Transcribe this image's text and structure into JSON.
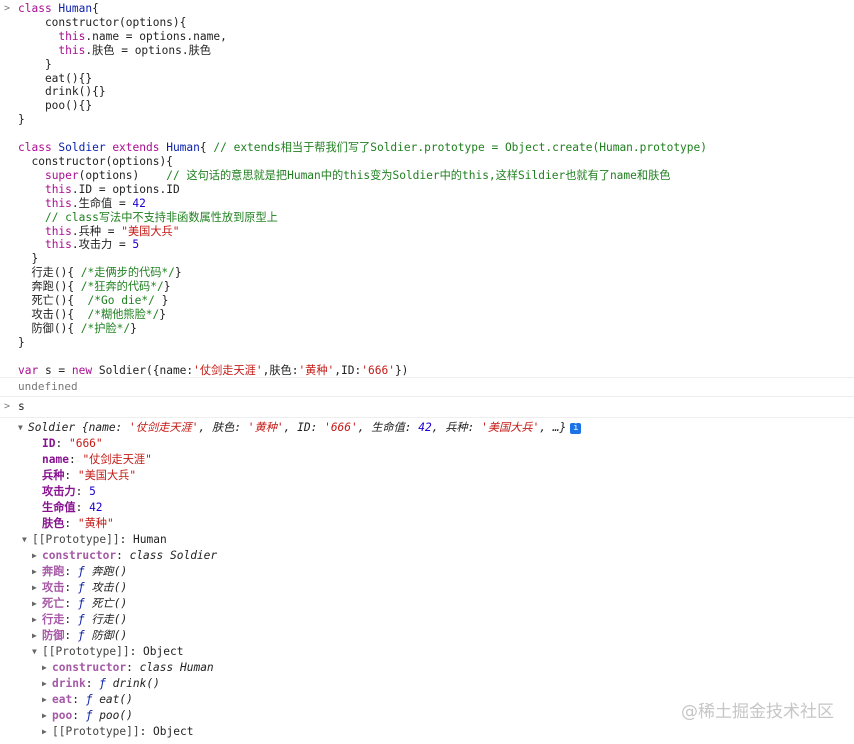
{
  "input1": {
    "prompt": ">",
    "lines": [
      [
        [
          "k",
          "class "
        ],
        [
          "t",
          "Human"
        ],
        [
          "p",
          "{"
        ]
      ],
      [
        [
          "p",
          "    constructor(options){"
        ]
      ],
      [
        [
          "p",
          "      "
        ],
        [
          "k",
          "this"
        ],
        [
          "p",
          ".name = options.name,"
        ]
      ],
      [
        [
          "p",
          "      "
        ],
        [
          "k",
          "this"
        ],
        [
          "p",
          ".肤色 = options.肤色"
        ]
      ],
      [
        [
          "p",
          "    }"
        ]
      ],
      [
        [
          "p",
          "    eat(){}"
        ]
      ],
      [
        [
          "p",
          "    drink(){}"
        ]
      ],
      [
        [
          "p",
          "    poo(){}"
        ]
      ],
      [
        [
          "p",
          "}"
        ]
      ],
      [
        [
          "p",
          ""
        ]
      ],
      [
        [
          "k",
          "class "
        ],
        [
          "t",
          "Soldier"
        ],
        [
          "k",
          " extends "
        ],
        [
          "t",
          "Human"
        ],
        [
          "p",
          "{ "
        ],
        [
          "c",
          "// extends相当于帮我们写了Soldier.prototype = Object.create(Human.prototype)"
        ]
      ],
      [
        [
          "p",
          "  constructor(options){"
        ]
      ],
      [
        [
          "p",
          "    "
        ],
        [
          "k",
          "super"
        ],
        [
          "p",
          "(options)    "
        ],
        [
          "c",
          "// 这句话的意思就是把Human中的this变为Soldier中的this,这样Sildier也就有了name和肤色"
        ]
      ],
      [
        [
          "p",
          "    "
        ],
        [
          "k",
          "this"
        ],
        [
          "p",
          ".ID = options.ID"
        ]
      ],
      [
        [
          "p",
          "    "
        ],
        [
          "k",
          "this"
        ],
        [
          "p",
          ".生命值 = "
        ],
        [
          "n",
          "42"
        ]
      ],
      [
        [
          "p",
          "    "
        ],
        [
          "c",
          "// class写法中不支持非函数属性放到原型上"
        ]
      ],
      [
        [
          "p",
          "    "
        ],
        [
          "k",
          "this"
        ],
        [
          "p",
          ".兵种 = "
        ],
        [
          "s",
          "\"美国大兵\""
        ]
      ],
      [
        [
          "p",
          "    "
        ],
        [
          "k",
          "this"
        ],
        [
          "p",
          ".攻击力 = "
        ],
        [
          "n",
          "5"
        ]
      ],
      [
        [
          "p",
          "  }"
        ]
      ],
      [
        [
          "p",
          "  行走(){ "
        ],
        [
          "c",
          "/*走俩步的代码*/"
        ],
        [
          "p",
          "}"
        ]
      ],
      [
        [
          "p",
          "  奔跑(){ "
        ],
        [
          "c",
          "/*狂奔的代码*/"
        ],
        [
          "p",
          "}"
        ]
      ],
      [
        [
          "p",
          "  死亡(){  "
        ],
        [
          "c",
          "/*Go die*/"
        ],
        [
          "p",
          " }"
        ]
      ],
      [
        [
          "p",
          "  攻击(){  "
        ],
        [
          "c",
          "/*糊他熊脸*/"
        ],
        [
          "p",
          "}"
        ]
      ],
      [
        [
          "p",
          "  防御(){ "
        ],
        [
          "c",
          "/*护脸*/"
        ],
        [
          "p",
          "}"
        ]
      ],
      [
        [
          "p",
          "}"
        ]
      ],
      [
        [
          "p",
          ""
        ]
      ],
      [
        [
          "k",
          "var "
        ],
        [
          "p",
          "s = "
        ],
        [
          "k",
          "new "
        ],
        [
          "p",
          "Soldier({name:"
        ],
        [
          "s",
          "'仗剑走天涯'"
        ],
        [
          "p",
          ",肤色:"
        ],
        [
          "s",
          "'黄种'"
        ],
        [
          "p",
          ",ID:"
        ],
        [
          "s",
          "'666'"
        ],
        [
          "p",
          "})"
        ]
      ]
    ]
  },
  "result1": "undefined",
  "input2": {
    "prompt": ">",
    "text": "s"
  },
  "tree": [
    {
      "indent": 0,
      "tri": "▼",
      "parts": [
        [
          "it",
          "Soldier {name: "
        ],
        [
          "stri",
          "'仗剑走天涯'"
        ],
        [
          "it",
          ", 肤色: "
        ],
        [
          "stri",
          "'黄种'"
        ],
        [
          "it",
          ", ID: "
        ],
        [
          "stri",
          "'666'"
        ],
        [
          "it",
          ", 生命值: "
        ],
        [
          "numi",
          "42"
        ],
        [
          "it",
          ", 兵种: "
        ],
        [
          "stri",
          "'美国大兵'"
        ],
        [
          "it",
          ", …}"
        ]
      ],
      "info": "i"
    },
    {
      "indent": 1,
      "tri": "",
      "parts": [
        [
          "key",
          "ID"
        ],
        [
          "p",
          ": "
        ],
        [
          "str",
          "\"666\""
        ]
      ]
    },
    {
      "indent": 1,
      "tri": "",
      "parts": [
        [
          "key",
          "name"
        ],
        [
          "p",
          ": "
        ],
        [
          "str",
          "\"仗剑走天涯\""
        ]
      ]
    },
    {
      "indent": 1,
      "tri": "",
      "parts": [
        [
          "key",
          "兵种"
        ],
        [
          "p",
          ": "
        ],
        [
          "str",
          "\"美国大兵\""
        ]
      ]
    },
    {
      "indent": 1,
      "tri": "",
      "parts": [
        [
          "key",
          "攻击力"
        ],
        [
          "p",
          ": "
        ],
        [
          "num",
          "5"
        ]
      ]
    },
    {
      "indent": 1,
      "tri": "",
      "parts": [
        [
          "key",
          "生命值"
        ],
        [
          "p",
          ": "
        ],
        [
          "num",
          "42"
        ]
      ]
    },
    {
      "indent": 1,
      "tri": "",
      "parts": [
        [
          "key",
          "肤色"
        ],
        [
          "p",
          ": "
        ],
        [
          "str",
          "\"黄种\""
        ]
      ]
    },
    {
      "indent": 1,
      "tri": "▼",
      "parts": [
        [
          "keyp",
          "[[Prototype]]"
        ],
        [
          "p",
          ": Human"
        ]
      ]
    },
    {
      "indent": 2,
      "tri": "▶",
      "parts": [
        [
          "key2",
          "constructor"
        ],
        [
          "p",
          ": "
        ],
        [
          "fn",
          "class Soldier"
        ]
      ]
    },
    {
      "indent": 2,
      "tri": "▶",
      "parts": [
        [
          "key2",
          "奔跑"
        ],
        [
          "p",
          ": "
        ],
        [
          "fnf",
          "ƒ "
        ],
        [
          "fn",
          "奔跑()"
        ]
      ]
    },
    {
      "indent": 2,
      "tri": "▶",
      "parts": [
        [
          "key2",
          "攻击"
        ],
        [
          "p",
          ": "
        ],
        [
          "fnf",
          "ƒ "
        ],
        [
          "fn",
          "攻击()"
        ]
      ]
    },
    {
      "indent": 2,
      "tri": "▶",
      "parts": [
        [
          "key2",
          "死亡"
        ],
        [
          "p",
          ": "
        ],
        [
          "fnf",
          "ƒ "
        ],
        [
          "fn",
          "死亡()"
        ]
      ]
    },
    {
      "indent": 2,
      "tri": "▶",
      "parts": [
        [
          "key2",
          "行走"
        ],
        [
          "p",
          ": "
        ],
        [
          "fnf",
          "ƒ "
        ],
        [
          "fn",
          "行走()"
        ]
      ]
    },
    {
      "indent": 2,
      "tri": "▶",
      "parts": [
        [
          "key2",
          "防御"
        ],
        [
          "p",
          ": "
        ],
        [
          "fnf",
          "ƒ "
        ],
        [
          "fn",
          "防御()"
        ]
      ]
    },
    {
      "indent": 2,
      "tri": "▼",
      "parts": [
        [
          "keyp",
          "[[Prototype]]"
        ],
        [
          "p",
          ": Object"
        ]
      ]
    },
    {
      "indent": 3,
      "tri": "▶",
      "parts": [
        [
          "key2",
          "constructor"
        ],
        [
          "p",
          ": "
        ],
        [
          "fn",
          "class Human"
        ]
      ]
    },
    {
      "indent": 3,
      "tri": "▶",
      "parts": [
        [
          "key2",
          "drink"
        ],
        [
          "p",
          ": "
        ],
        [
          "fnf",
          "ƒ "
        ],
        [
          "fn",
          "drink()"
        ]
      ]
    },
    {
      "indent": 3,
      "tri": "▶",
      "parts": [
        [
          "key2",
          "eat"
        ],
        [
          "p",
          ": "
        ],
        [
          "fnf",
          "ƒ "
        ],
        [
          "fn",
          "eat()"
        ]
      ]
    },
    {
      "indent": 3,
      "tri": "▶",
      "parts": [
        [
          "key2",
          "poo"
        ],
        [
          "p",
          ": "
        ],
        [
          "fnf",
          "ƒ "
        ],
        [
          "fn",
          "poo()"
        ]
      ]
    },
    {
      "indent": 3,
      "tri": "▶",
      "parts": [
        [
          "keyp",
          "[[Prototype]]"
        ],
        [
          "p",
          ": Object"
        ]
      ]
    }
  ],
  "watermark": "@稀土掘金技术社区"
}
